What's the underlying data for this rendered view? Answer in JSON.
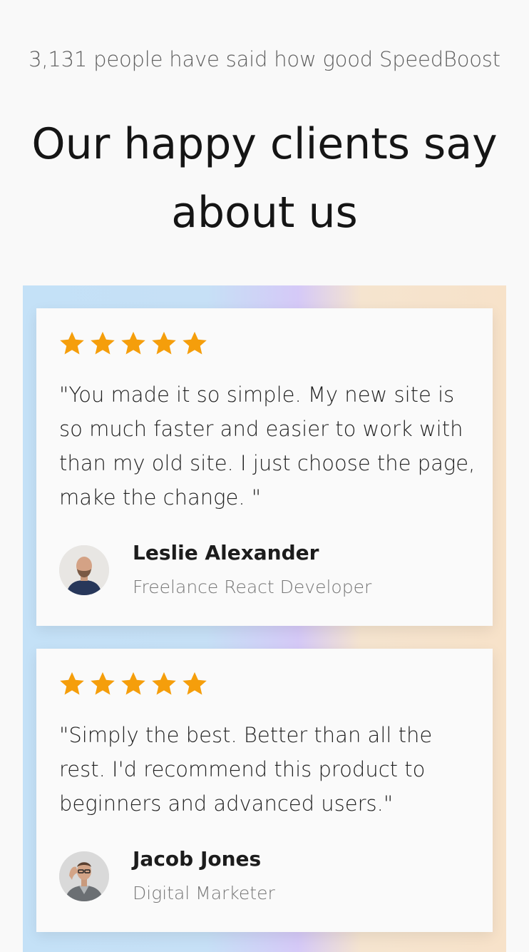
{
  "header": {
    "eyebrow": "3,131 people have said how good SpeedBoost",
    "headline": "Our happy clients say about us"
  },
  "colors": {
    "star": "#f59e0b",
    "band_gradient": [
      "#c4e1f7",
      "#d5c9f7",
      "#f7e2c9"
    ]
  },
  "testimonials": [
    {
      "rating": 5,
      "quote": "\"You made it so simple. My new site is so much faster and easier to work with than my old site. I just choose the page, make the change. \"",
      "name": "Leslie Alexander",
      "role": "Freelance React Developer",
      "avatar_icon": "user-avatar"
    },
    {
      "rating": 5,
      "quote": "\"Simply the best. Better than all the rest. I'd recommend this product to beginners and advanced users.\"",
      "name": "Jacob Jones",
      "role": "Digital Marketer",
      "avatar_icon": "user-avatar"
    }
  ]
}
